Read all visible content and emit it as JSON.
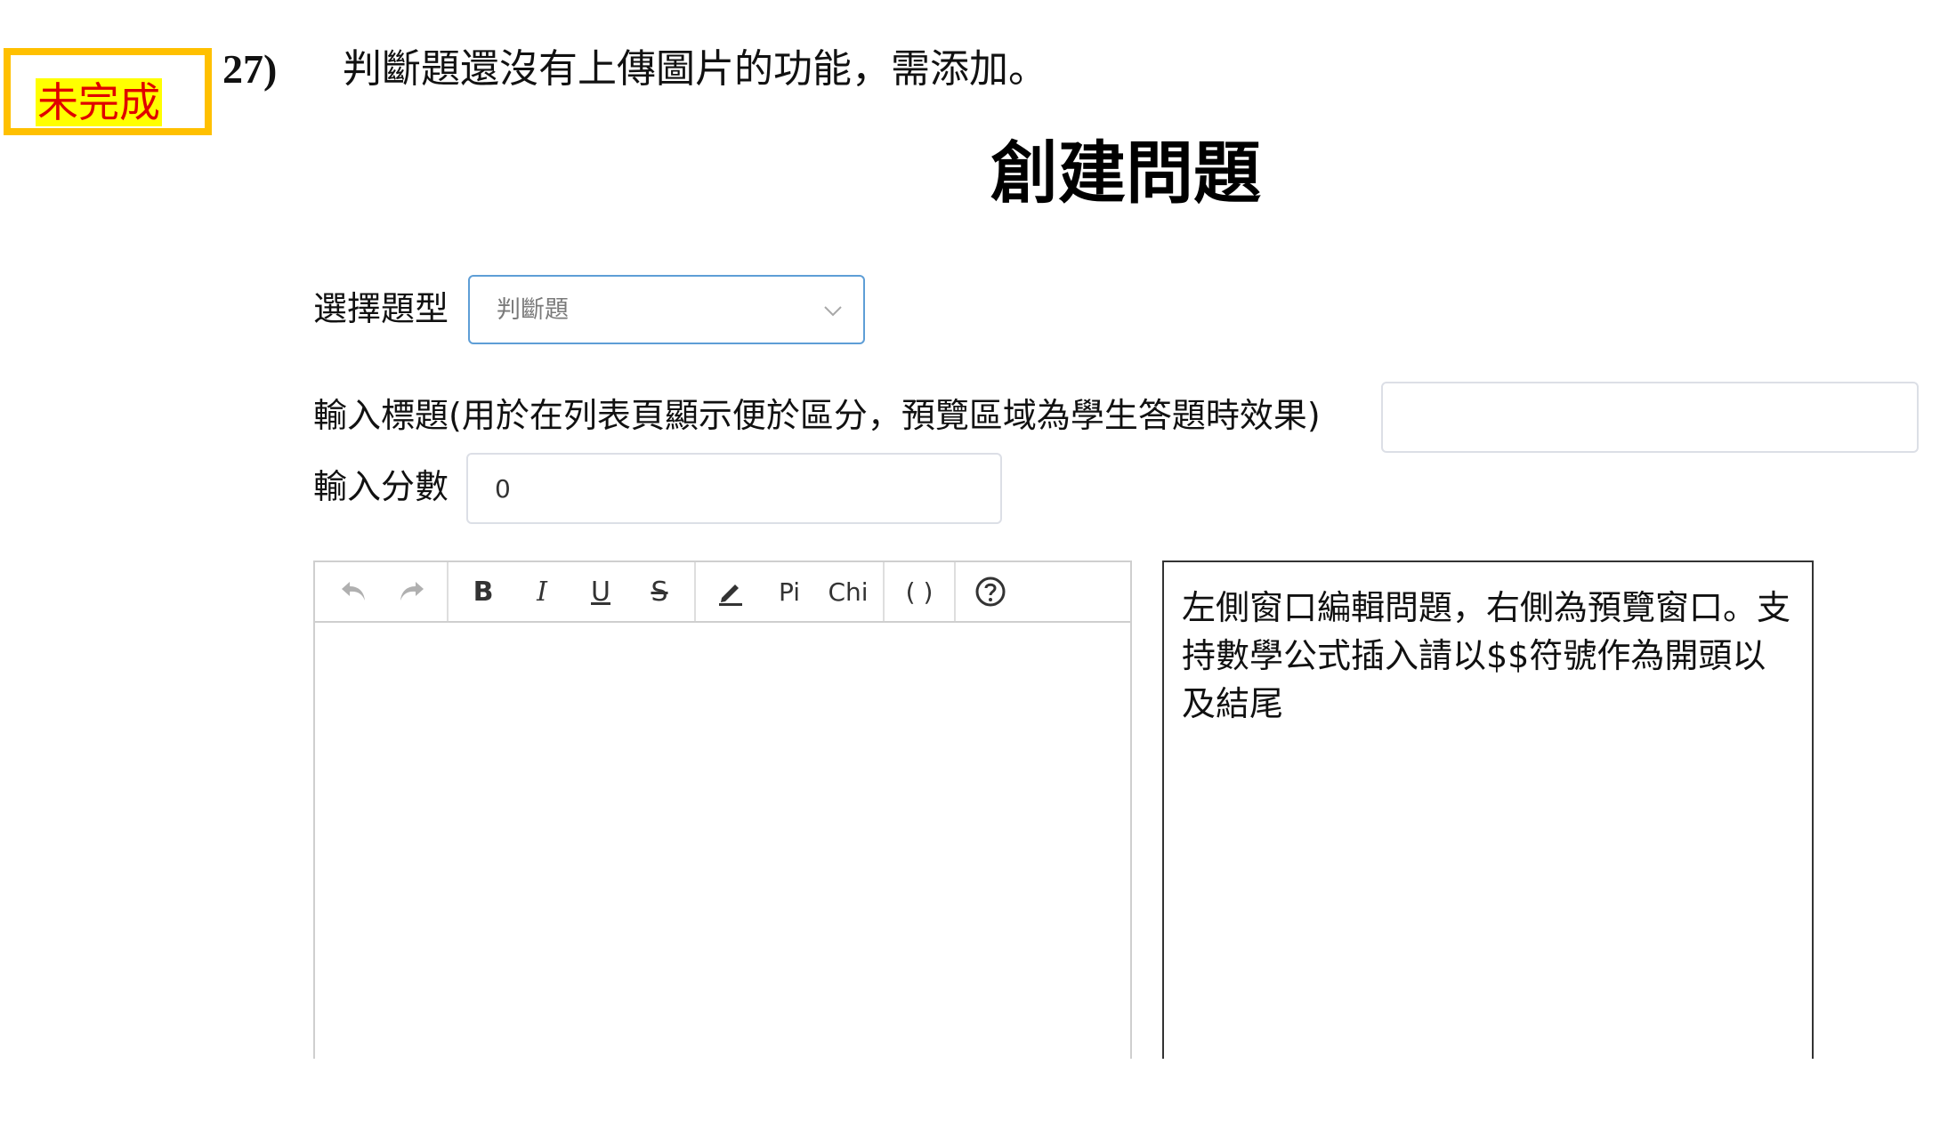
{
  "status_label": "未完成",
  "note": {
    "number": "27)",
    "text": "判斷題還沒有上傳圖片的功能，需添加。"
  },
  "page_title": "創建問題",
  "question_type": {
    "label": "選擇題型",
    "selected": "判斷題"
  },
  "title_field": {
    "label": "輸入標題(用於在列表頁顯示便於區分，預覽區域為學生答題時效果)",
    "value": ""
  },
  "score_field": {
    "label": "輸入分數",
    "value": "0"
  },
  "toolbar": {
    "undo": "undo-icon",
    "redo": "redo-icon",
    "bold": "B",
    "italic": "I",
    "underline": "U",
    "strike": "S",
    "pen": "pen-icon",
    "pi": "Pi",
    "chi": "Chi",
    "paren": "( )",
    "help": "help-icon"
  },
  "preview_text": "左側窗口編輯問題，右側為預覽窗口。支持數學公式插入請以$$符號作為開頭以及結尾",
  "colors": {
    "status_border": "#ffc000",
    "status_highlight": "#ffff00",
    "status_text": "#e00000",
    "select_border": "#5e9ed6"
  }
}
